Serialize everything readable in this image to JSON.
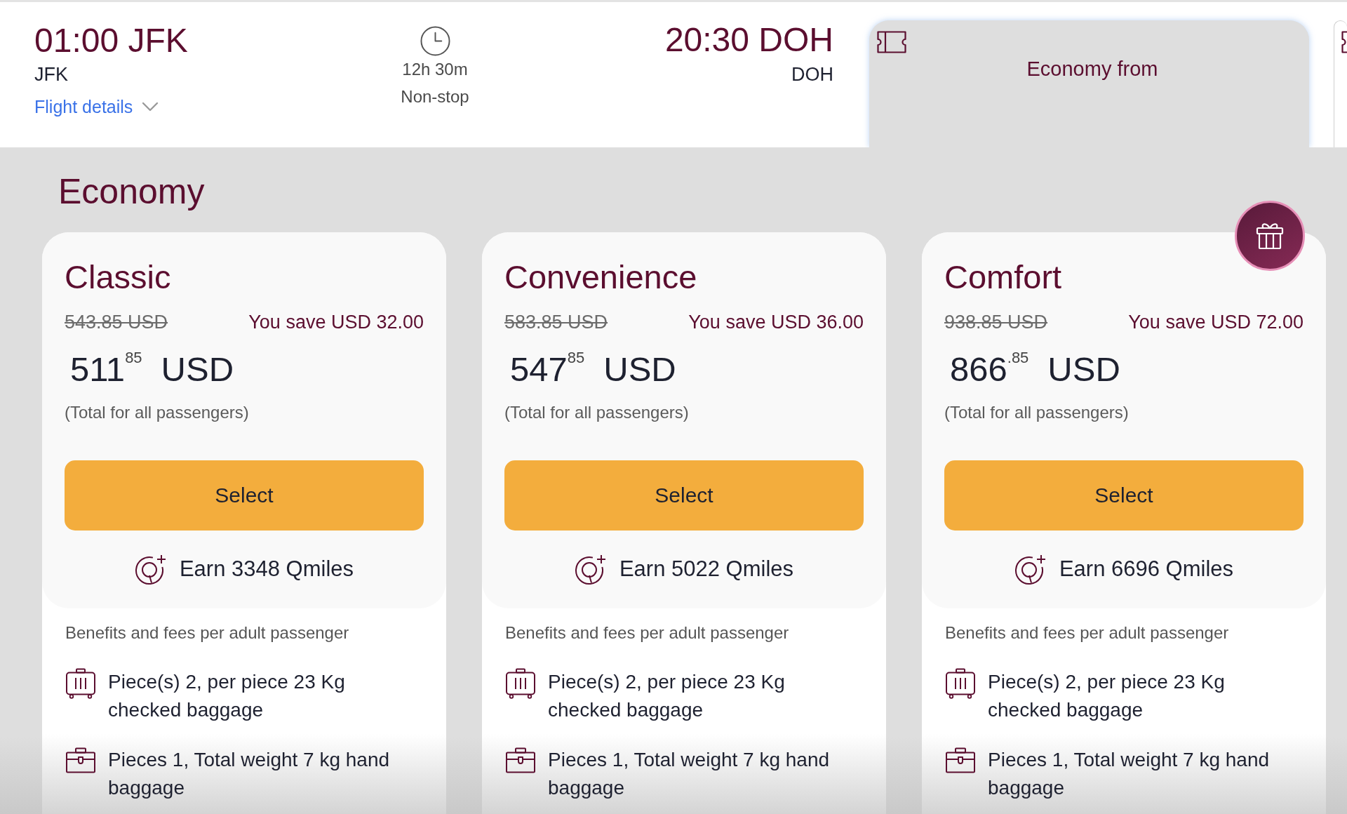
{
  "flight": {
    "departure": {
      "time_airport": "01:00 JFK",
      "airport": "JFK"
    },
    "flight_details_link": "Flight details",
    "duration": "12h 30m",
    "stops": "Non-stop",
    "arrival": {
      "time_airport": "20:30 DOH",
      "airport": "DOH"
    }
  },
  "fare_tabs": [
    {
      "label": "Economy from",
      "selected": true
    },
    {
      "selected": false
    }
  ],
  "cabin": {
    "title": "Economy",
    "fare_cards": [
      {
        "name": "Classic",
        "gift_badge": false,
        "old_price": "543.85 USD",
        "savings": "You save USD 32.00",
        "price": "511$^{85}$",
        "currency": "USD",
        "price_note": "(Total for all passengers)",
        "select_button": "Select",
        "qmiles": "Earn 3348 Qmiles",
        "benefits_title": "Benefits and fees per adult passenger",
        "benefits": [
          {
            "kind": "checked-baggage",
            "text": "Piece(s) 2, per piece 23 Kg checked baggage"
          },
          {
            "kind": "hand-baggage",
            "text": "Pieces 1, Total weight 7 kg hand baggage"
          }
        ]
      },
      {
        "name": "Convenience",
        "gift_badge": false,
        "old_price": "583.85 USD",
        "savings": "You save USD 36.00",
        "price": "547$^{85}$",
        "currency": "USD",
        "price_note": "(Total for all passengers)",
        "select_button": "Select",
        "qmiles": "Earn 5022 Qmiles",
        "benefits_title": "Benefits and fees per adult passenger",
        "benefits": [
          {
            "kind": "checked-baggage",
            "text": "Piece(s) 2, per piece 23 Kg checked baggage"
          },
          {
            "kind": "hand-baggage",
            "text": "Pieces 1, Total weight 7 kg hand baggage"
          }
        ]
      },
      {
        "name": "Comfort",
        "gift_badge": true,
        "old_price": "938.85 USD",
        "savings": "You save USD 72.00",
        "price": "866$^{.85}$",
        "currency": "USD",
        "price_note": "(Total for all passengers)",
        "select_button": "Select",
        "qmiles": "Earn 6696 Qmiles",
        "benefits_title": "Benefits and fees per adult passenger",
        "benefits": [
          {
            "kind": "checked-baggage",
            "text": "Piece(s) 2, per piece 23 Kg checked baggage"
          },
          {
            "kind": "hand-baggage",
            "text": "Pieces 1, Total weight 7 kg hand baggage"
          }
        ]
      }
    ]
  }
}
